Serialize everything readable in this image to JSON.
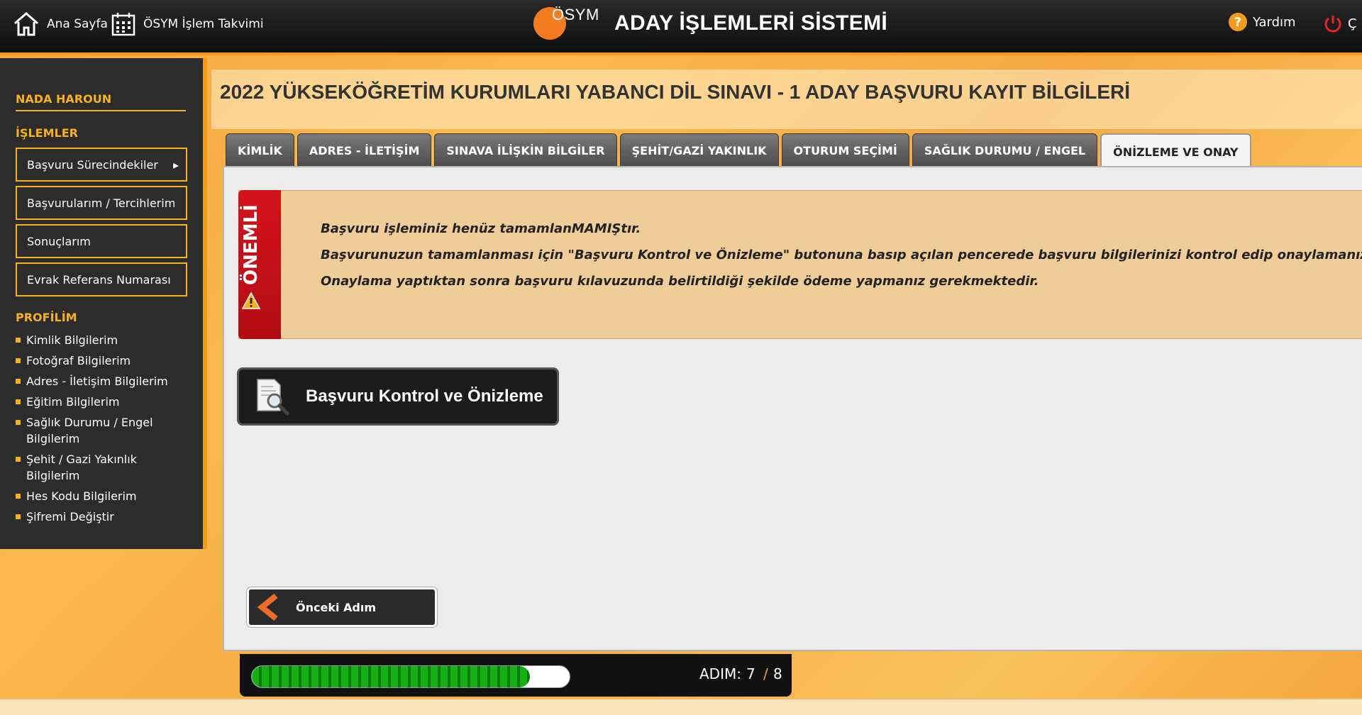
{
  "header": {
    "home_label": "Ana Sayfa",
    "calendar_label": "ÖSYM İşlem Takvimi",
    "logo_text": "ÖSYM",
    "title": "ADAY İŞLEMLERİ SİSTEMİ",
    "help_label": "Yardım",
    "logout_label": "Ç",
    "colors": {
      "accent": "#f39a1e",
      "bar": "#111111"
    }
  },
  "sidebar": {
    "user_name": "NADA HAROUN",
    "operations_heading": "İŞLEMLER",
    "operations": [
      {
        "label": "Başvuru Sürecindekiler"
      },
      {
        "label": "Başvurularım / Tercihlerim"
      },
      {
        "label": "Sonuçlarım"
      },
      {
        "label": "Evrak Referans Numarası"
      }
    ],
    "profile_heading": "PROFİLİM",
    "profile_items": [
      {
        "label": "Kimlik Bilgilerim"
      },
      {
        "label": "Fotoğraf Bilgilerim"
      },
      {
        "label": "Adres - İletişim Bilgilerim"
      },
      {
        "label": "Eğitim Bilgilerim"
      },
      {
        "label": "Sağlık Durumu / Engel Bilgilerim"
      },
      {
        "label": "Şehit / Gazi Yakınlık Bilgilerim"
      },
      {
        "label": "Hes Kodu Bilgilerim"
      },
      {
        "label": "Şifremi Değiştir"
      }
    ]
  },
  "main": {
    "page_title": "2022 YÜKSEKÖĞRETİM KURUMLARI YABANCI DİL SINAVI - 1 ADAY BAŞVURU KAYIT BİLGİLERİ",
    "tabs": [
      {
        "label": "KİMLİK"
      },
      {
        "label": "ADRES - İLETİŞİM"
      },
      {
        "label": "SINAVA İLİŞKİN BİLGİLER"
      },
      {
        "label": "ŞEHİT/GAZİ YAKINLIK"
      },
      {
        "label": "OTURUM SEÇİMİ"
      },
      {
        "label": "SAĞLIK DURUMU / ENGEL"
      },
      {
        "label": "ÖNİZLEME VE ONAY",
        "active": true
      }
    ],
    "notice": {
      "ribbon_label": "ÖNEMLİ",
      "items": [
        "Başvuru işleminiz henüz tamamlanMAMIŞtır.",
        "Başvurunuzun tamamlanması için \"Başvuru Kontrol ve Önizleme\" butonuna basıp açılan pencerede başvuru bilgilerinizi kontrol edip onaylamanız gerekmektedir.",
        "Onaylama yaptıktan sonra başvuru kılavuzunda belirtildiği şekilde ödeme yapmanız gerekmektedir."
      ]
    },
    "preview_button_label": "Başvuru Kontrol ve Önizleme",
    "previous_button_label": "Önceki Adım"
  },
  "progress": {
    "label": "ADIM:",
    "current": "7",
    "separator": "/",
    "total": "8",
    "fraction": 0.875
  }
}
